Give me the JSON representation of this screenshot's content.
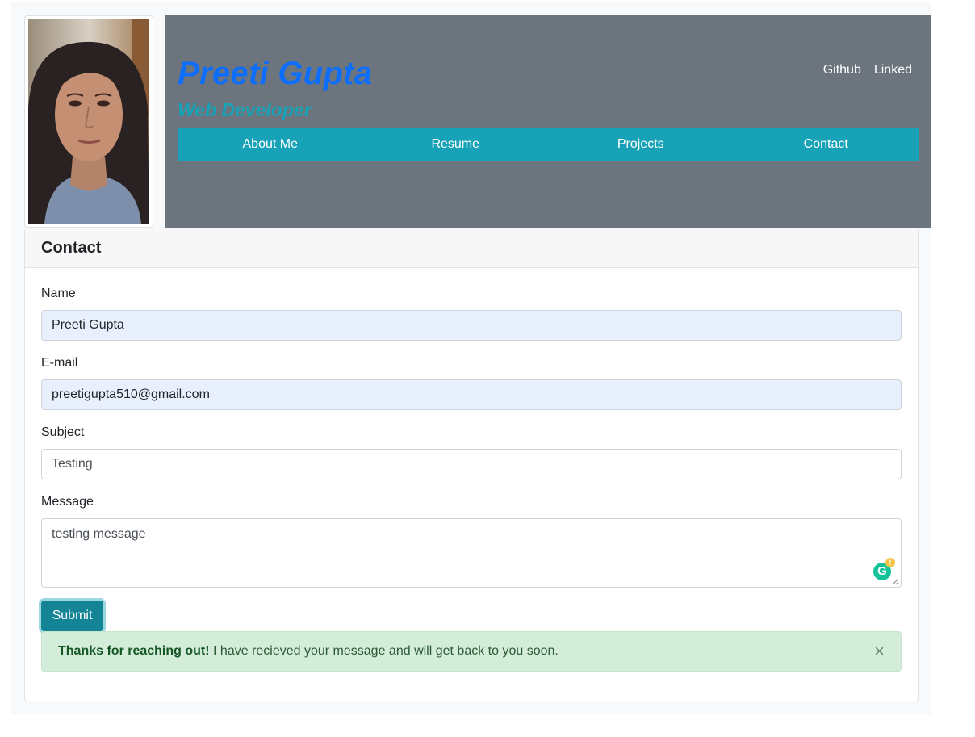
{
  "profile": {
    "name": "Preeti Gupta",
    "role": "Web Developer"
  },
  "external_links": [
    "Github",
    "Linked"
  ],
  "nav": [
    "About Me",
    "Resume",
    "Projects",
    "Contact"
  ],
  "contact": {
    "title": "Contact",
    "name_label": "Name",
    "name_value": "Preeti Gupta",
    "email_label": "E-mail",
    "email_value": "preetigupta510@gmail.com",
    "subject_label": "Subject",
    "subject_value": "Testing",
    "message_label": "Message",
    "message_value": "testing message",
    "submit_label": "Submit"
  },
  "alert": {
    "strong": "Thanks for reaching out!",
    "message": "I have recieved your message and will get back to you soon.",
    "close": "×"
  },
  "colors": {
    "header_bg": "#6c757d",
    "nav_bg": "#17a2b8",
    "name_color": "#0d6efd",
    "role_color": "#17a2b8",
    "submit_bg": "#138496",
    "alert_bg": "#d4edda"
  }
}
